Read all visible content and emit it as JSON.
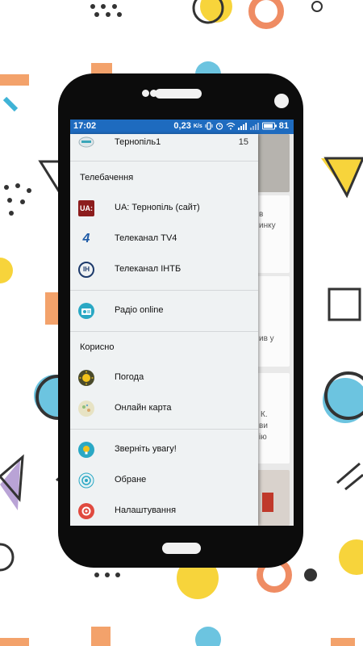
{
  "statusbar": {
    "time": "17:02",
    "net_speed": "0,23",
    "net_unit": "K/s",
    "battery": "81"
  },
  "drawer": {
    "top_item": {
      "label": "Тернопіль1",
      "count": "15",
      "icon": "city-icon"
    },
    "sections": [
      {
        "title": "Телебачення",
        "items": [
          {
            "label": "UA: Тернопіль (сайт)",
            "icon": "ua-tv-logo-icon",
            "icon_text": "UA:"
          },
          {
            "label": "Телеканал TV4",
            "icon": "tv4-logo-icon",
            "icon_text": "4"
          },
          {
            "label": "Телеканал ІНТБ",
            "icon": "intb-logo-icon",
            "icon_text": "IH"
          }
        ]
      },
      {
        "title": "",
        "items": [
          {
            "label": "Радіо online",
            "icon": "radio-icon"
          }
        ]
      },
      {
        "title": "Корисно",
        "items": [
          {
            "label": "Погода",
            "icon": "sun-icon"
          },
          {
            "label": "Онлайн карта",
            "icon": "map-icon"
          }
        ]
      },
      {
        "title": "",
        "items": [
          {
            "label": "Зверніть увагу!",
            "icon": "lightbulb-icon"
          },
          {
            "label": "Обране",
            "icon": "favorite-icon"
          },
          {
            "label": "Налаштування",
            "icon": "settings-icon"
          }
        ]
      }
    ]
  },
  "background_content": {
    "fragments": [
      "в",
      "инку",
      "ив у",
      "К.",
      "ви",
      "ію"
    ]
  },
  "colors": {
    "statusbar": "#1e6bbf",
    "drawer_bg": "#eff2f3",
    "phone_body": "#0c0c0c",
    "settings_red": "#e04a3f",
    "teal": "#2aa8c4",
    "sun_yellow": "#f2c21b"
  }
}
